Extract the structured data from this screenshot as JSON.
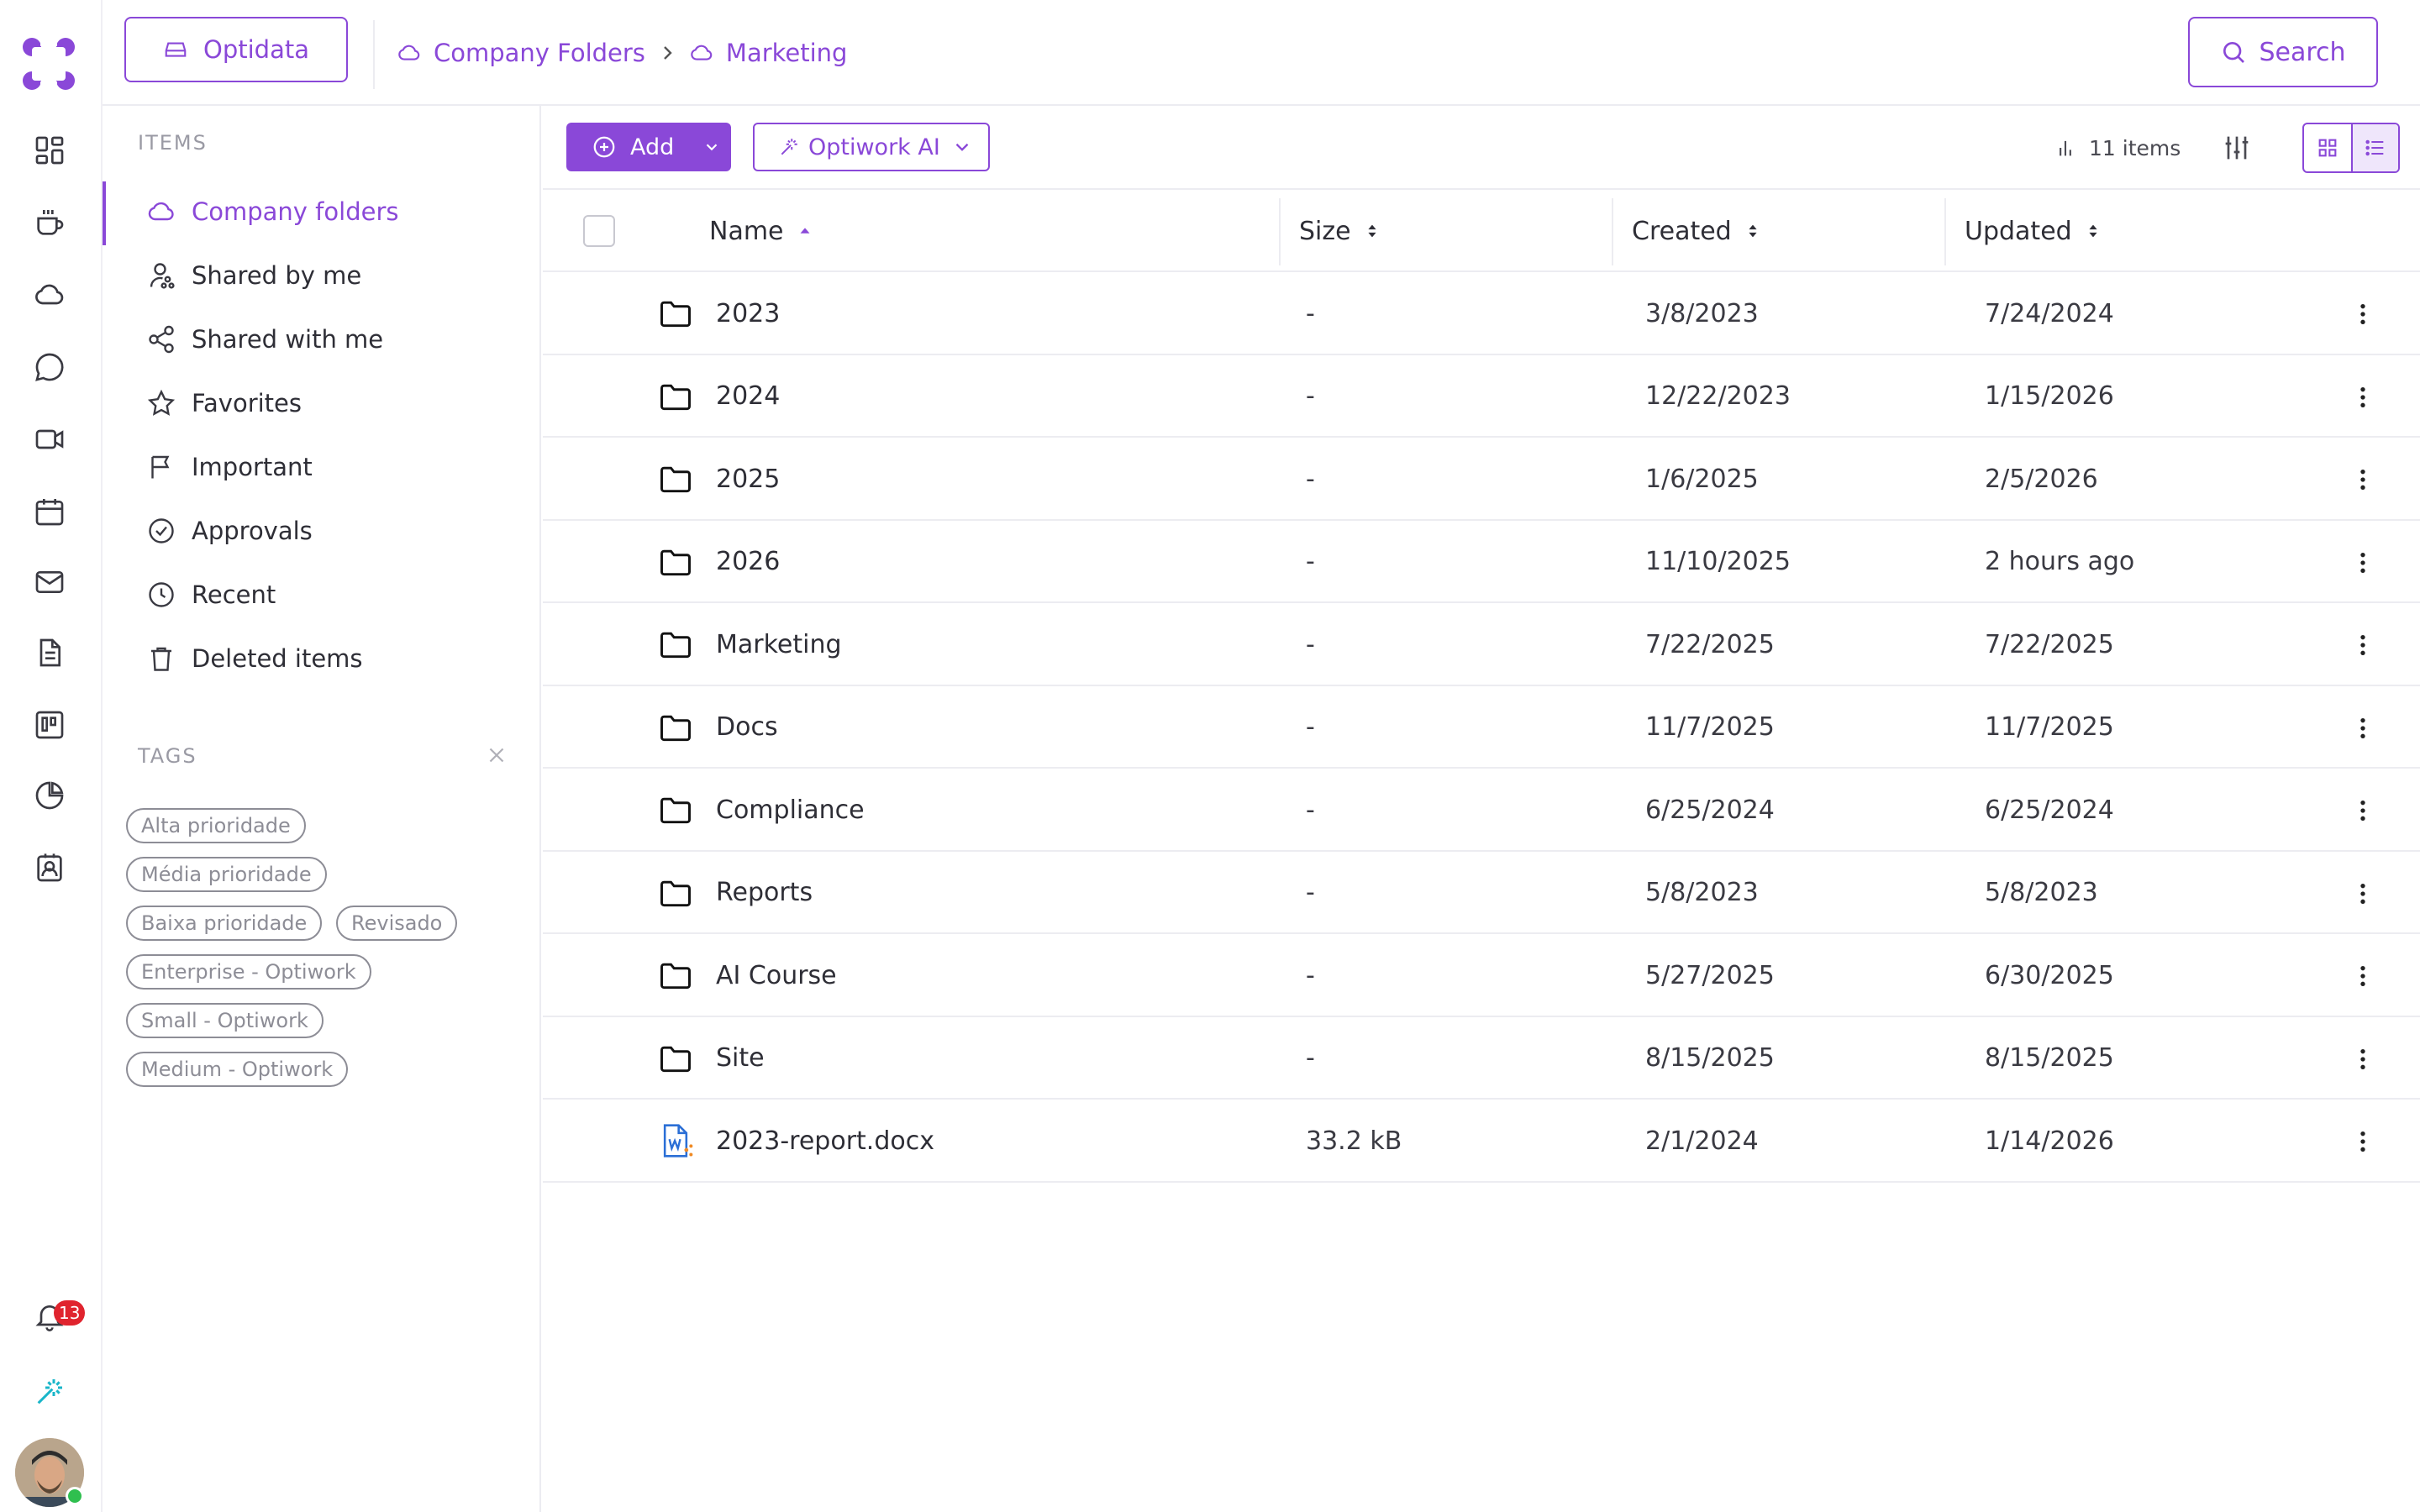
{
  "workspace": {
    "label": "Optidata"
  },
  "breadcrumb": [
    {
      "label": "Company Folders"
    },
    {
      "label": "Marketing"
    }
  ],
  "search": {
    "label": "Search"
  },
  "sidebar": {
    "items_header": "ITEMS",
    "items": [
      {
        "label": "Company folders",
        "icon": "cloud-icon",
        "active": true
      },
      {
        "label": "Shared by me",
        "icon": "user-share-icon"
      },
      {
        "label": "Shared with me",
        "icon": "share-icon"
      },
      {
        "label": "Favorites",
        "icon": "star-icon"
      },
      {
        "label": "Important",
        "icon": "flag-icon"
      },
      {
        "label": "Approvals",
        "icon": "check-circle-icon"
      },
      {
        "label": "Recent",
        "icon": "clock-icon"
      },
      {
        "label": "Deleted items",
        "icon": "trash-icon"
      }
    ],
    "tags_header": "TAGS",
    "tags": [
      "Alta prioridade",
      "Média prioridade",
      "Baixa prioridade",
      "Revisado",
      "Enterprise - Optiwork",
      "Small - Optiwork",
      "Medium - Optiwork"
    ]
  },
  "rail": {
    "icons": [
      "dashboard-icon",
      "coffee-icon",
      "cloud-icon",
      "chat-icon",
      "video-icon",
      "calendar-icon",
      "mail-icon",
      "document-icon",
      "board-icon",
      "pie-chart-icon",
      "contact-icon"
    ],
    "notifications_count": "13",
    "bottom_icons": [
      "bell-icon",
      "magic-wand-icon"
    ]
  },
  "toolbar": {
    "add_label": "Add",
    "ai_label": "Optiwork AI",
    "item_count": "11 items"
  },
  "table": {
    "columns": {
      "name": "Name",
      "size": "Size",
      "created": "Created",
      "updated": "Updated"
    },
    "rows": [
      {
        "name": "2023",
        "type": "folder",
        "size": "-",
        "created": "3/8/2023",
        "updated": "7/24/2024"
      },
      {
        "name": "2024",
        "type": "folder",
        "size": "-",
        "created": "12/22/2023",
        "updated": "1/15/2026"
      },
      {
        "name": "2025",
        "type": "folder",
        "size": "-",
        "created": "1/6/2025",
        "updated": "2/5/2026"
      },
      {
        "name": "2026",
        "type": "folder",
        "size": "-",
        "created": "11/10/2025",
        "updated": "2 hours ago"
      },
      {
        "name": "Marketing",
        "type": "folder",
        "size": "-",
        "created": "7/22/2025",
        "updated": "7/22/2025"
      },
      {
        "name": "Docs",
        "type": "folder",
        "size": "-",
        "created": "11/7/2025",
        "updated": "11/7/2025"
      },
      {
        "name": "Compliance",
        "type": "folder",
        "size": "-",
        "created": "6/25/2024",
        "updated": "6/25/2024"
      },
      {
        "name": "Reports",
        "type": "folder",
        "size": "-",
        "created": "5/8/2023",
        "updated": "5/8/2023"
      },
      {
        "name": "AI Course",
        "type": "folder",
        "size": "-",
        "created": "5/27/2025",
        "updated": "6/30/2025"
      },
      {
        "name": "Site",
        "type": "folder",
        "size": "-",
        "created": "8/15/2025",
        "updated": "8/15/2025"
      },
      {
        "name": "2023-report.docx",
        "type": "word-doc",
        "size": "33.2 kB",
        "created": "2/1/2024",
        "updated": "1/14/2026"
      }
    ]
  },
  "colors": {
    "accent": "#8a48d8",
    "badge": "#e0242e",
    "online": "#2fbf4f"
  }
}
